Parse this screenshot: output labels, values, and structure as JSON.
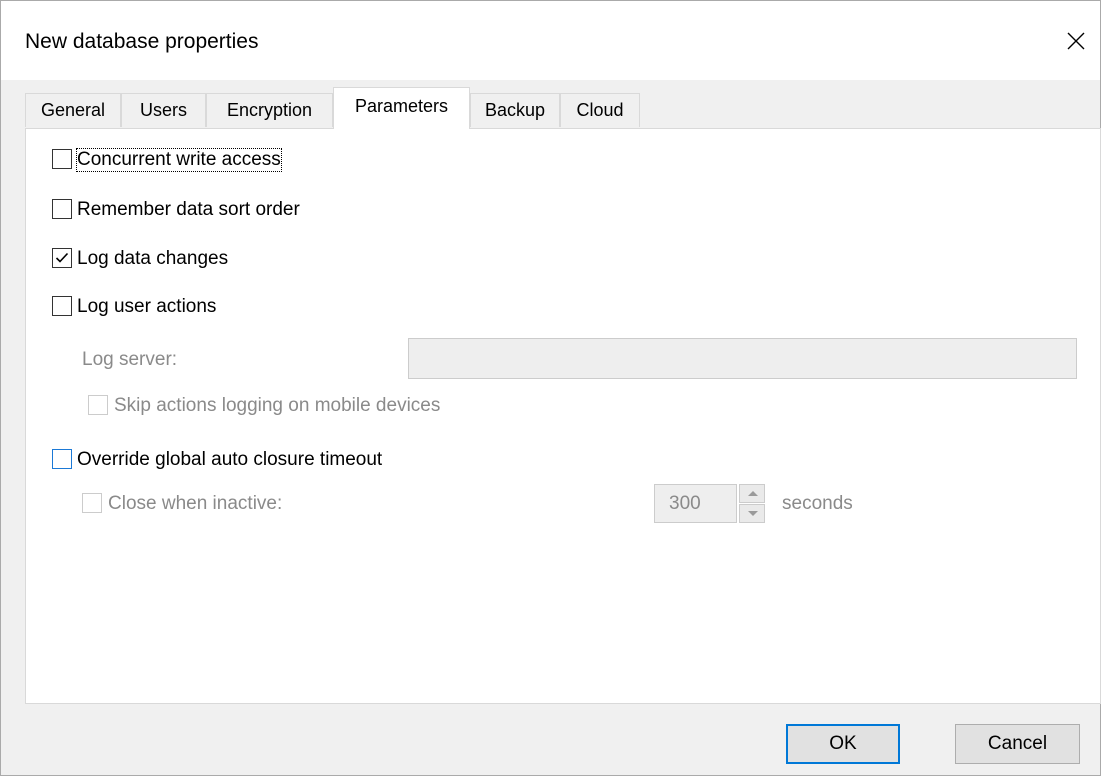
{
  "window": {
    "title": "New database properties"
  },
  "tabs": [
    {
      "label": "General"
    },
    {
      "label": "Users"
    },
    {
      "label": "Encryption"
    },
    {
      "label": "Parameters",
      "active": true
    },
    {
      "label": "Backup"
    },
    {
      "label": "Cloud"
    }
  ],
  "params": {
    "concurrent_write": {
      "label": "Concurrent write access",
      "checked": false
    },
    "remember_sort": {
      "label": "Remember data sort order",
      "checked": false
    },
    "log_data_changes": {
      "label": "Log data changes",
      "checked": true
    },
    "log_user_actions": {
      "label": "Log user actions",
      "checked": false
    },
    "log_server": {
      "label": "Log server:",
      "value": ""
    },
    "skip_mobile": {
      "label": "Skip actions logging on mobile devices",
      "checked": false
    },
    "override_timeout": {
      "label": "Override global auto closure timeout",
      "checked": false
    },
    "close_inactive": {
      "label": "Close when inactive:",
      "checked": false
    },
    "timeout_value": "300",
    "timeout_unit": "seconds"
  },
  "buttons": {
    "ok": "OK",
    "cancel": "Cancel"
  },
  "colors": {
    "focus_blue": "#0078d7",
    "disabled_text": "#8a8a8a"
  },
  "icons": {
    "close": "close-icon",
    "check": "checkmark-icon",
    "spin_up": "arrow-up-icon",
    "spin_down": "arrow-down-icon"
  }
}
